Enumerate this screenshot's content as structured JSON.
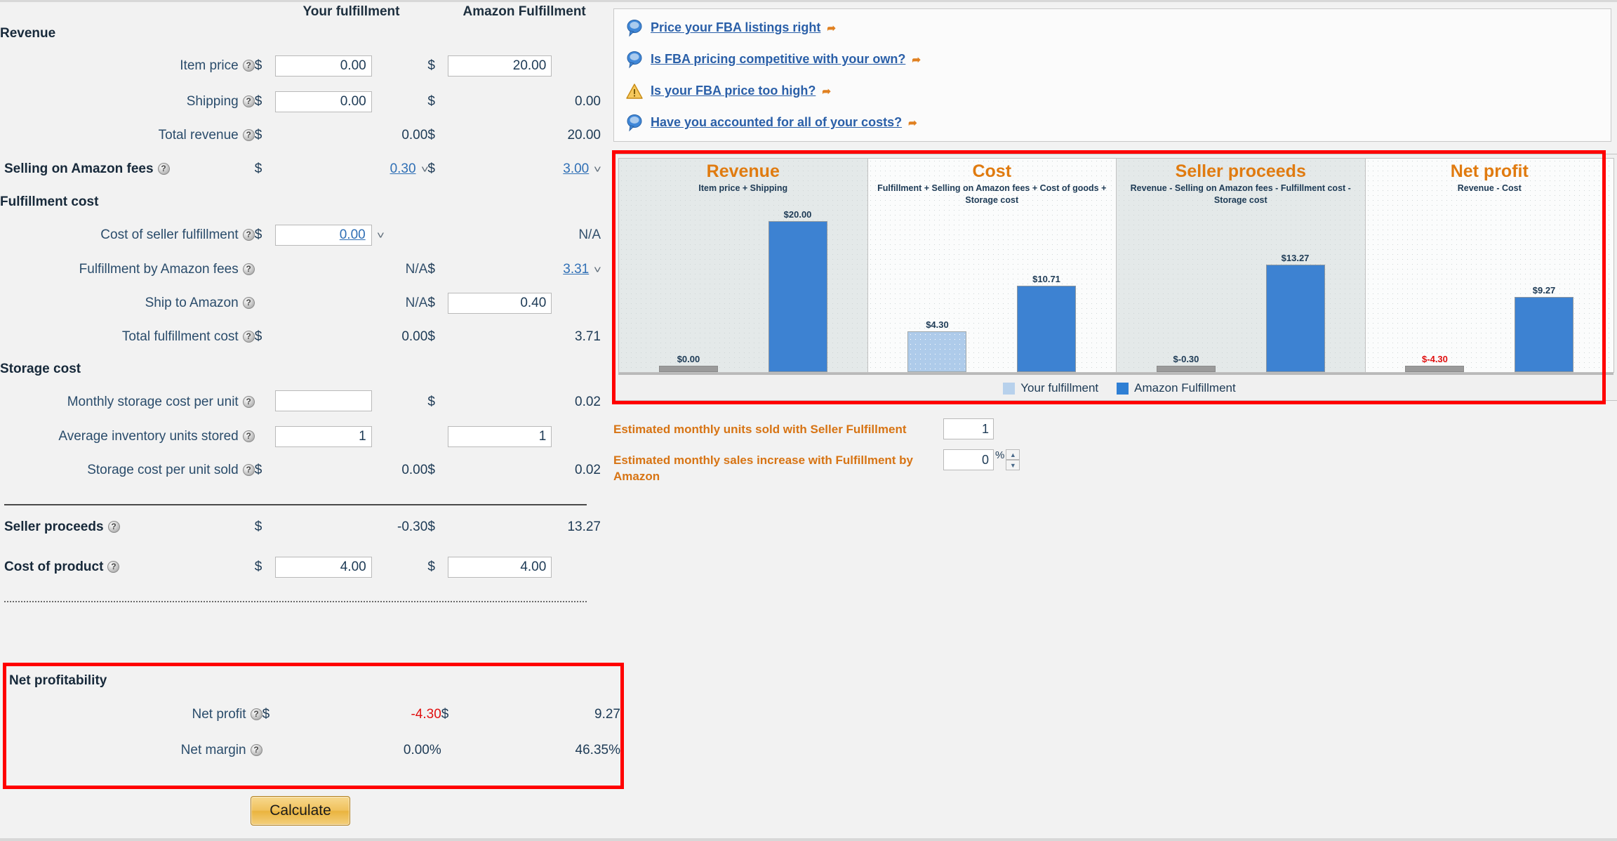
{
  "columns": {
    "your": "Your fulfillment",
    "amazon": "Amazon Fulfillment"
  },
  "sections": {
    "revenue_title": "Revenue",
    "fulfillment_title": "Fulfillment cost",
    "storage_title": "Storage cost",
    "net_title": "Net profitability"
  },
  "rows": {
    "item_price": {
      "label": "Item price",
      "your": "0.00",
      "amazon": "20.00"
    },
    "shipping": {
      "label": "Shipping",
      "your": "0.00",
      "amazon": "0.00"
    },
    "total_revenue": {
      "label": "Total revenue",
      "your": "0.00",
      "amazon": "20.00"
    },
    "selling_fees": {
      "label": "Selling on Amazon fees",
      "your": "0.30",
      "amazon": "3.00"
    },
    "cost_seller_ful": {
      "label": "Cost of seller fulfillment",
      "your": "0.00",
      "amazon": "N/A"
    },
    "fba_fees": {
      "label": "Fulfillment by Amazon fees",
      "your": "N/A",
      "amazon": "3.31"
    },
    "ship_to_amazon": {
      "label": "Ship to Amazon",
      "your": "N/A",
      "amazon": "0.40"
    },
    "total_ful_cost": {
      "label": "Total fulfillment cost",
      "your": "0.00",
      "amazon": "3.71"
    },
    "monthly_storage": {
      "label": "Monthly storage cost per unit",
      "your": "",
      "amazon": "0.02"
    },
    "avg_inventory": {
      "label": "Average inventory units stored",
      "your": "1",
      "amazon": "1"
    },
    "storage_per_unit": {
      "label": "Storage cost per unit sold",
      "your": "0.00",
      "amazon": "0.02"
    },
    "seller_proceeds": {
      "label": "Seller proceeds",
      "your": "-0.30",
      "amazon": "13.27"
    },
    "cost_of_product": {
      "label": "Cost of product",
      "your": "4.00",
      "amazon": "4.00"
    },
    "net_profit": {
      "label": "Net profit",
      "your": "-4.30",
      "amazon": "9.27"
    },
    "net_margin": {
      "label": "Net margin",
      "your": "0.00%",
      "amazon": "46.35%"
    }
  },
  "currency_symbol": "$",
  "calculate_button": "Calculate",
  "tips": [
    {
      "icon": "speech-bubble-icon",
      "text": "Price your FBA listings right"
    },
    {
      "icon": "speech-bubble-icon",
      "text": "Is FBA pricing competitive with your own?"
    },
    {
      "icon": "warning-triangle-icon",
      "text": "Is your FBA price too high?"
    },
    {
      "icon": "speech-bubble-icon",
      "text": "Have you accounted for all of your costs?"
    }
  ],
  "estimates": {
    "units_label": "Estimated monthly units sold with Seller Fulfillment",
    "units_value": "1",
    "increase_label": "Estimated monthly sales increase with Fulfillment by Amazon",
    "increase_value": "0",
    "percent_symbol": "%"
  },
  "chart_data": {
    "type": "bar",
    "title": "",
    "categories": [
      "Revenue",
      "Cost",
      "Seller proceeds",
      "Net profit"
    ],
    "panel_subtitles": [
      "Item price + Shipping",
      "Fulfillment + Selling on Amazon fees + Cost of goods + Storage cost",
      "Revenue - Selling on Amazon fees - Fulfillment cost - Storage cost",
      "Revenue - Cost"
    ],
    "series": [
      {
        "name": "Your fulfillment",
        "values": [
          0.0,
          4.3,
          -0.3,
          -4.3
        ],
        "labels": [
          "$0.00",
          "$4.30",
          "$-0.30",
          "$-4.30"
        ],
        "color": "#aecbea"
      },
      {
        "name": "Amazon Fulfillment",
        "values": [
          20.0,
          10.71,
          13.27,
          9.27
        ],
        "labels": [
          "$20.00",
          "$10.71",
          "$13.27",
          "$9.27"
        ],
        "color": "#3d82d2"
      }
    ],
    "ylim": [
      0,
      20
    ],
    "grid": false,
    "legend_position": "bottom",
    "xlabel": "",
    "ylabel": ""
  },
  "colors": {
    "accent_orange": "#e07b10",
    "link_blue": "#2a5fa8",
    "negative_red": "#e01010",
    "highlight_box": "#ff0000",
    "bar_light": "#aecbea",
    "bar_dark": "#3d82d2"
  }
}
